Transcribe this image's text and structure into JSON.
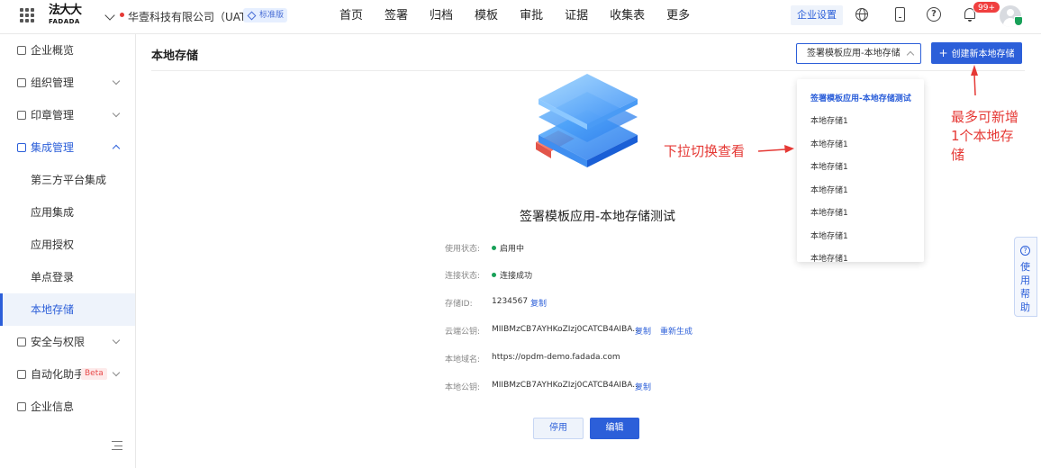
{
  "header": {
    "logo_cn": "法大大",
    "logo_en": "FADADA",
    "company_name": "华壹科技有限公司（UAT）",
    "plan_badge": "标准版",
    "nav": [
      "首页",
      "签署",
      "归档",
      "模板",
      "审批",
      "证据",
      "收集表",
      "更多"
    ],
    "settings_label": "企业设置",
    "notification_count": "99+"
  },
  "sidebar": {
    "items": [
      {
        "label": "企业概览"
      },
      {
        "label": "组织管理"
      },
      {
        "label": "印章管理"
      },
      {
        "label": "集成管理"
      },
      {
        "label": "第三方平台集成"
      },
      {
        "label": "应用集成"
      },
      {
        "label": "应用授权"
      },
      {
        "label": "单点登录"
      },
      {
        "label": "本地存储"
      },
      {
        "label": "安全与权限"
      },
      {
        "label": "自动化助手"
      },
      {
        "label": "企业信息"
      }
    ],
    "beta_label": "Beta"
  },
  "main": {
    "title": "本地存储",
    "selected_storage": "签署模板应用-本地存储测",
    "create_button": "创建新本地存储",
    "dropdown_items": [
      "签署模板应用-本地存储测试",
      "本地存储1",
      "本地存储1",
      "本地存储1",
      "本地存储1",
      "本地存储1",
      "本地存储1",
      "本地存储1"
    ],
    "storage_name": "签署模板应用-本地存储测试",
    "fields": {
      "status_label": "使用状态:",
      "status_value": "启用中",
      "connection_label": "连接状态:",
      "connection_value": "连接成功",
      "id_label": "存储ID:",
      "id_value": "1234567",
      "cloud_key_label": "云端公钥:",
      "cloud_key_value": "MIIBMzCB7AYHKoZIzj0CATCB4AIBA...",
      "domain_label": "本地域名:",
      "domain_value": "https://opdm-demo.fadada.com",
      "local_key_label": "本地公钥:",
      "local_key_value": "MIIBMzCB7AYHKoZIzj0CATCB4AIBA..."
    },
    "copy_label": "复制",
    "regenerate_label": "重新生成",
    "disable_button": "停用",
    "edit_button": "编辑"
  },
  "help_tab": "使用帮助",
  "annotations": {
    "dropdown_hint": "下拉切换查看",
    "create_hint": "最多可新增1个本地存储"
  },
  "colors": {
    "primary": "#2c5fd9",
    "annotation": "#e53935",
    "success": "#18a058"
  }
}
